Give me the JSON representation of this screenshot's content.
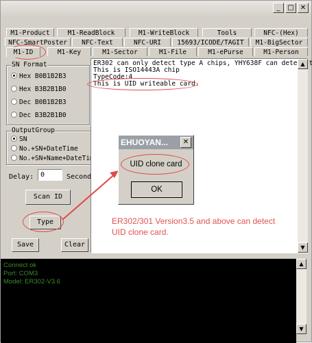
{
  "window": {
    "title": ""
  },
  "title_buttons": {
    "minimize": "_",
    "maximize": "□",
    "close": "✕"
  },
  "tabs": {
    "row1": [
      "M1-Product",
      "M1-ReadBlock",
      "M1-WriteBlock",
      "Tools",
      "NFC-(Hex)"
    ],
    "row2": [
      "NFC-SmartPoster",
      "NFC-Text",
      "NFC-URI",
      "15693/ICODE/TAGIT",
      "M1-BigSector"
    ],
    "row3": [
      "M1-ID",
      "M1-Key",
      "M1-Sector",
      "M1-File",
      "M1-ePurse",
      "M1-Person"
    ],
    "active": "M1-ID"
  },
  "sn_format": {
    "title": "SN Format",
    "options": [
      {
        "label": "Hex B0B1B2B3",
        "selected": true
      },
      {
        "label": "Hex B3B2B1B0",
        "selected": false
      },
      {
        "label": "Dec B0B1B2B3",
        "selected": false
      },
      {
        "label": "Dec B3B2B1B0",
        "selected": false
      }
    ]
  },
  "output_group": {
    "title": "OutputGroup",
    "options": [
      {
        "label": "SN",
        "selected": true
      },
      {
        "label": "No.+SN+DateTime",
        "selected": false
      },
      {
        "label": "No.+SN+Name+DateTime",
        "selected": false
      }
    ]
  },
  "delay": {
    "label": "Delay:",
    "value": "0",
    "unit": "Second"
  },
  "buttons": {
    "scan_id": "Scan ID",
    "type": "Type",
    "save": "Save",
    "clear": "Clear"
  },
  "output_text": [
    "ER302 can only detect type A chips, YHY638F can detect t",
    "This is ISO14443A chip",
    "TypeCode:4",
    "This is UID writeable card."
  ],
  "console": [
    "Connect ok",
    "Port: COM3",
    "Model: ER302-V3.6"
  ],
  "dialog": {
    "title": "EHUOYAN...",
    "message": "UID clone card",
    "ok": "OK"
  },
  "annotation": {
    "line1": "ER302/301 Version3.5 and above can detect",
    "line2": "UID clone card.",
    "color": "#e0524d"
  },
  "scroll_arrows": {
    "up": "▲",
    "down": "▼"
  }
}
